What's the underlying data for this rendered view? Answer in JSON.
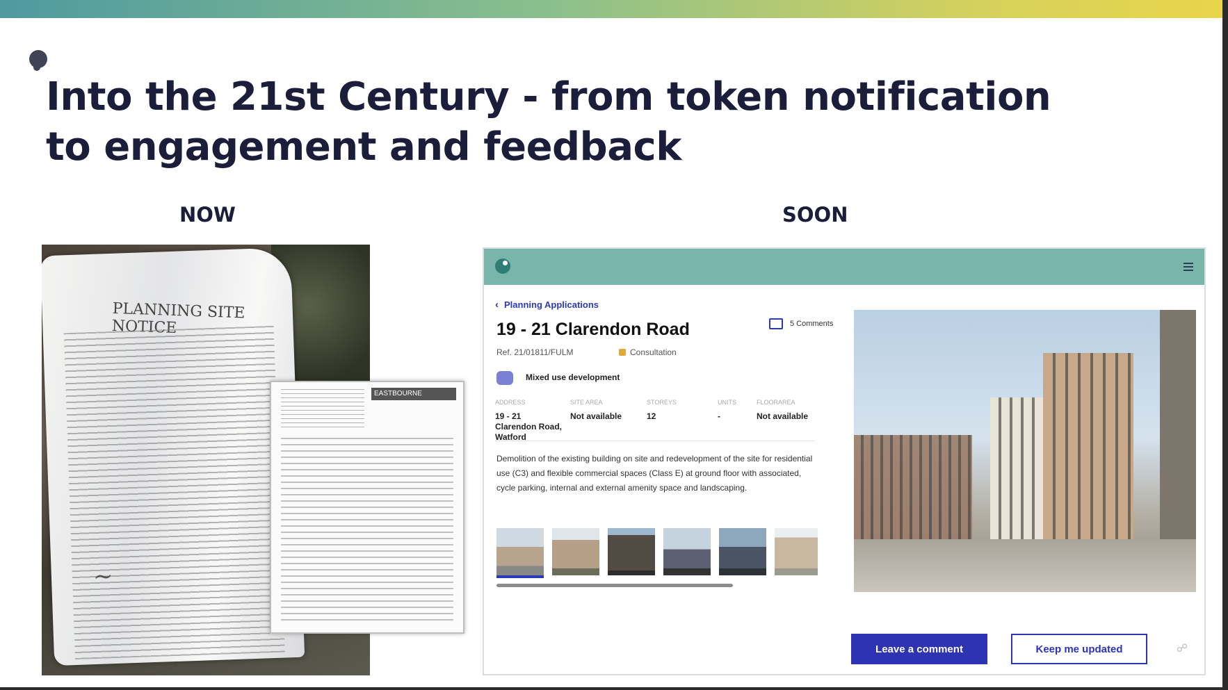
{
  "slide": {
    "title": "Into the 21st Century - from token notification to engagement and feedback",
    "now_label": "NOW",
    "soon_label": "SOON"
  },
  "notice_photo": {
    "heading": "PLANNING SITE NOTICE",
    "second_notice_logo": "EASTBOURNE"
  },
  "app": {
    "back_label": "Planning Applications",
    "address": "19 - 21 Clarendon Road",
    "comments": "5 Comments",
    "ref": "Ref. 21/01811/FULM",
    "status": "Consultation",
    "development_type": "Mixed use development",
    "stats": [
      {
        "key": "ADDRESS",
        "value": "19 - 21 Clarendon Road, Watford"
      },
      {
        "key": "SITE AREA",
        "value": "Not available"
      },
      {
        "key": "STOREYS",
        "value": "12"
      },
      {
        "key": "UNITS",
        "value": "-"
      },
      {
        "key": "FLOORAREA",
        "value": "Not available"
      }
    ],
    "description": "Demolition of the existing building on site and redevelopment of the site for residential use (C3) and flexible commercial spaces (Class E) at ground floor with associated, cycle parking, internal and external amenity space and landscaping.",
    "buttons": {
      "comment": "Leave a comment",
      "update": "Keep me updated"
    },
    "icons": [
      "menu-icon",
      "chevron-left-icon",
      "comment-icon",
      "building-icon",
      "share-icon"
    ]
  },
  "colors": {
    "title": "#1c1d3a",
    "app_header": "#7ab5ab",
    "primary": "#2e33b3",
    "status": "#e0a73a"
  }
}
